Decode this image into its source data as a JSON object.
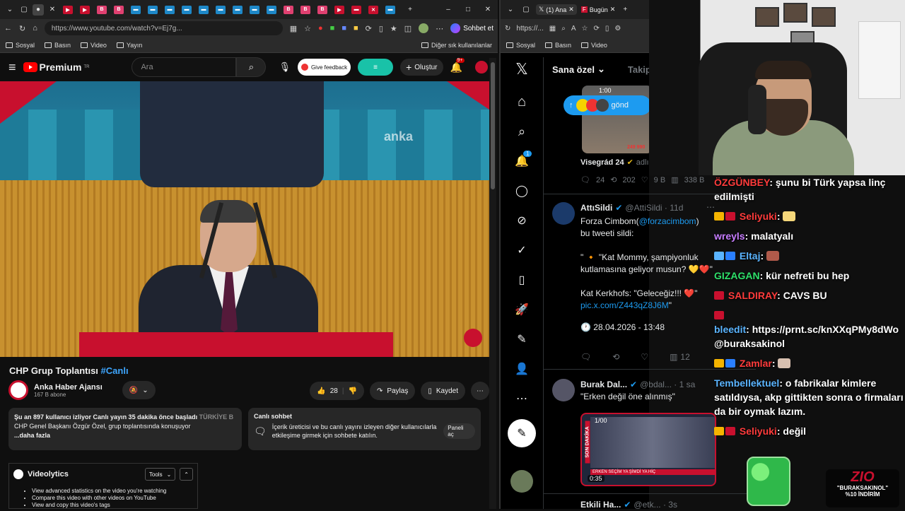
{
  "left_browser": {
    "url": "https://www.youtube.com/watch?v=Ej7g...",
    "copilot_label": "Sohbet et",
    "bookmarks": [
      "Sosyal",
      "Basın",
      "Video",
      "Yayın"
    ],
    "other_bookmarks": "Diğer sık kullanılanlar"
  },
  "youtube": {
    "logo_label": "Premium",
    "logo_region": "TR",
    "search_placeholder": "Ara",
    "feedback_label": "Give feedback",
    "create_label": "Oluştur",
    "notif_count": "9+",
    "video_watermark": "anka",
    "video_title": "CHP Grup Toplantısı",
    "video_title_tag": "#Canlı",
    "channel_name": "Anka Haber Ajansı",
    "subscribers": "167 B abone",
    "likes": "28",
    "share_label": "Paylaş",
    "save_label": "Kaydet",
    "desc_stats": "Şu an 897 kullanıcı izliyor  Canlı yayın 35 dakika önce başladı",
    "desc_stats_tag": "TÜRKİYE B",
    "desc_text": "CHP Genel Başkanı Özgür Özel, grup toplantısında konuşuyor",
    "desc_more": "...daha fazla",
    "chat_title": "Canlı sohbet",
    "chat_text": "İçerik üreticisi ve bu canlı yayını izleyen diğer kullanıcılarla etkileşime girmek için sohbete katılın.",
    "chat_button": "Paneli aç",
    "videolytics_title": "Videolytics",
    "tools_label": "Tools",
    "videolytics_items": [
      "View advanced statistics on the video you're watching",
      "Compare this video with other videos on YouTube",
      "View and copy this video's tags"
    ]
  },
  "right_browser": {
    "tab1": "(1) Ana",
    "tab2": "Bugün",
    "url": "https://...",
    "bookmarks": [
      "Sosyal",
      "Basın",
      "Video"
    ]
  },
  "x": {
    "tab_foryou": "Sana özel",
    "tab_following": "Takip e",
    "notif_badge": "1",
    "post_toast": "gönd",
    "t0_author": "Visegrád 24",
    "t0_handle": "adlı",
    "t0_stats": [
      "24",
      "202",
      "9 B",
      "338 B"
    ],
    "t0_media_counter": "1:00",
    "t0_media_views": "249 990",
    "t1_author": "AttıSildi",
    "t1_handle": "@AttiSildi · 11d",
    "t1_line1": "Forza Cimbom(",
    "t1_line1_link": "@forzacimbom",
    "t1_line1_end": ")",
    "t1_line2": "bu tweeti sildi:",
    "t1_quote1": "\" 🔸 \"Kat Mommy, şampiyonluk kutlamasına geliyor musun? 💛❤️\"",
    "t1_quote2": "Kat Kerkhofs: \"Geleceğiz!!! ❤️\"",
    "t1_link": "pic.x.com/Z443qZ8J6M",
    "t1_link_end": "\"",
    "t1_time": "🕐 28.04.2026 - 13:48",
    "t1_views": "12",
    "t2_author": "Burak Dal...",
    "t2_handle": "@bdal... · 1 sa",
    "t2_text": "\"Erken değil öne alınmış\"",
    "t2_media_counter": "1/00",
    "t2_media_time": "0:35",
    "t2_media_label": "SON DAKİKA",
    "t2_media_caption": "ERKEN SEÇİM YA ŞİMDİ YA HİÇ",
    "t3_author": "Etkili Ha...",
    "t3_handle": "@etk... · 3s"
  },
  "stream_chat": [
    {
      "user": "ÖZGÜNBEY",
      "color": "#ff3b3b",
      "msg": "şunu bi Türk yapsa linç edilmişti"
    },
    {
      "user": "Seliyuki",
      "color": "#ff3b3b",
      "msg": ""
    },
    {
      "user": "wreyls",
      "color": "#c77dff",
      "msg": "malatyalı"
    },
    {
      "user": "Eltaj",
      "color": "#5ab4ff",
      "msg": ""
    },
    {
      "user": "GIZAGAN",
      "color": "#2ee06a",
      "msg": "kür nefreti bu hep"
    },
    {
      "user": "SALDIRAY",
      "color": "#ff3b3b",
      "msg": "CAVS BU"
    },
    {
      "user": "bleedit",
      "color": "#5ab4ff",
      "msg": "https://prnt.sc/knXXqPMy8dWo @buraksakinol"
    },
    {
      "user": "Zamlar",
      "color": "#ff3b3b",
      "msg": ""
    },
    {
      "user": "Tembellektuel",
      "color": "#5ab4ff",
      "msg": "o fabrikalar kimlere satıldıysa, akp gittikten sonra o firmaları da bir oymak lazım."
    },
    {
      "user": "Seliyuki",
      "color": "#ff3b3b",
      "msg": "değil"
    }
  ],
  "promo": {
    "logo": "ZIO",
    "code": "\"BURAKSAKINOL\"",
    "discount": "%10 İNDİRİM"
  }
}
